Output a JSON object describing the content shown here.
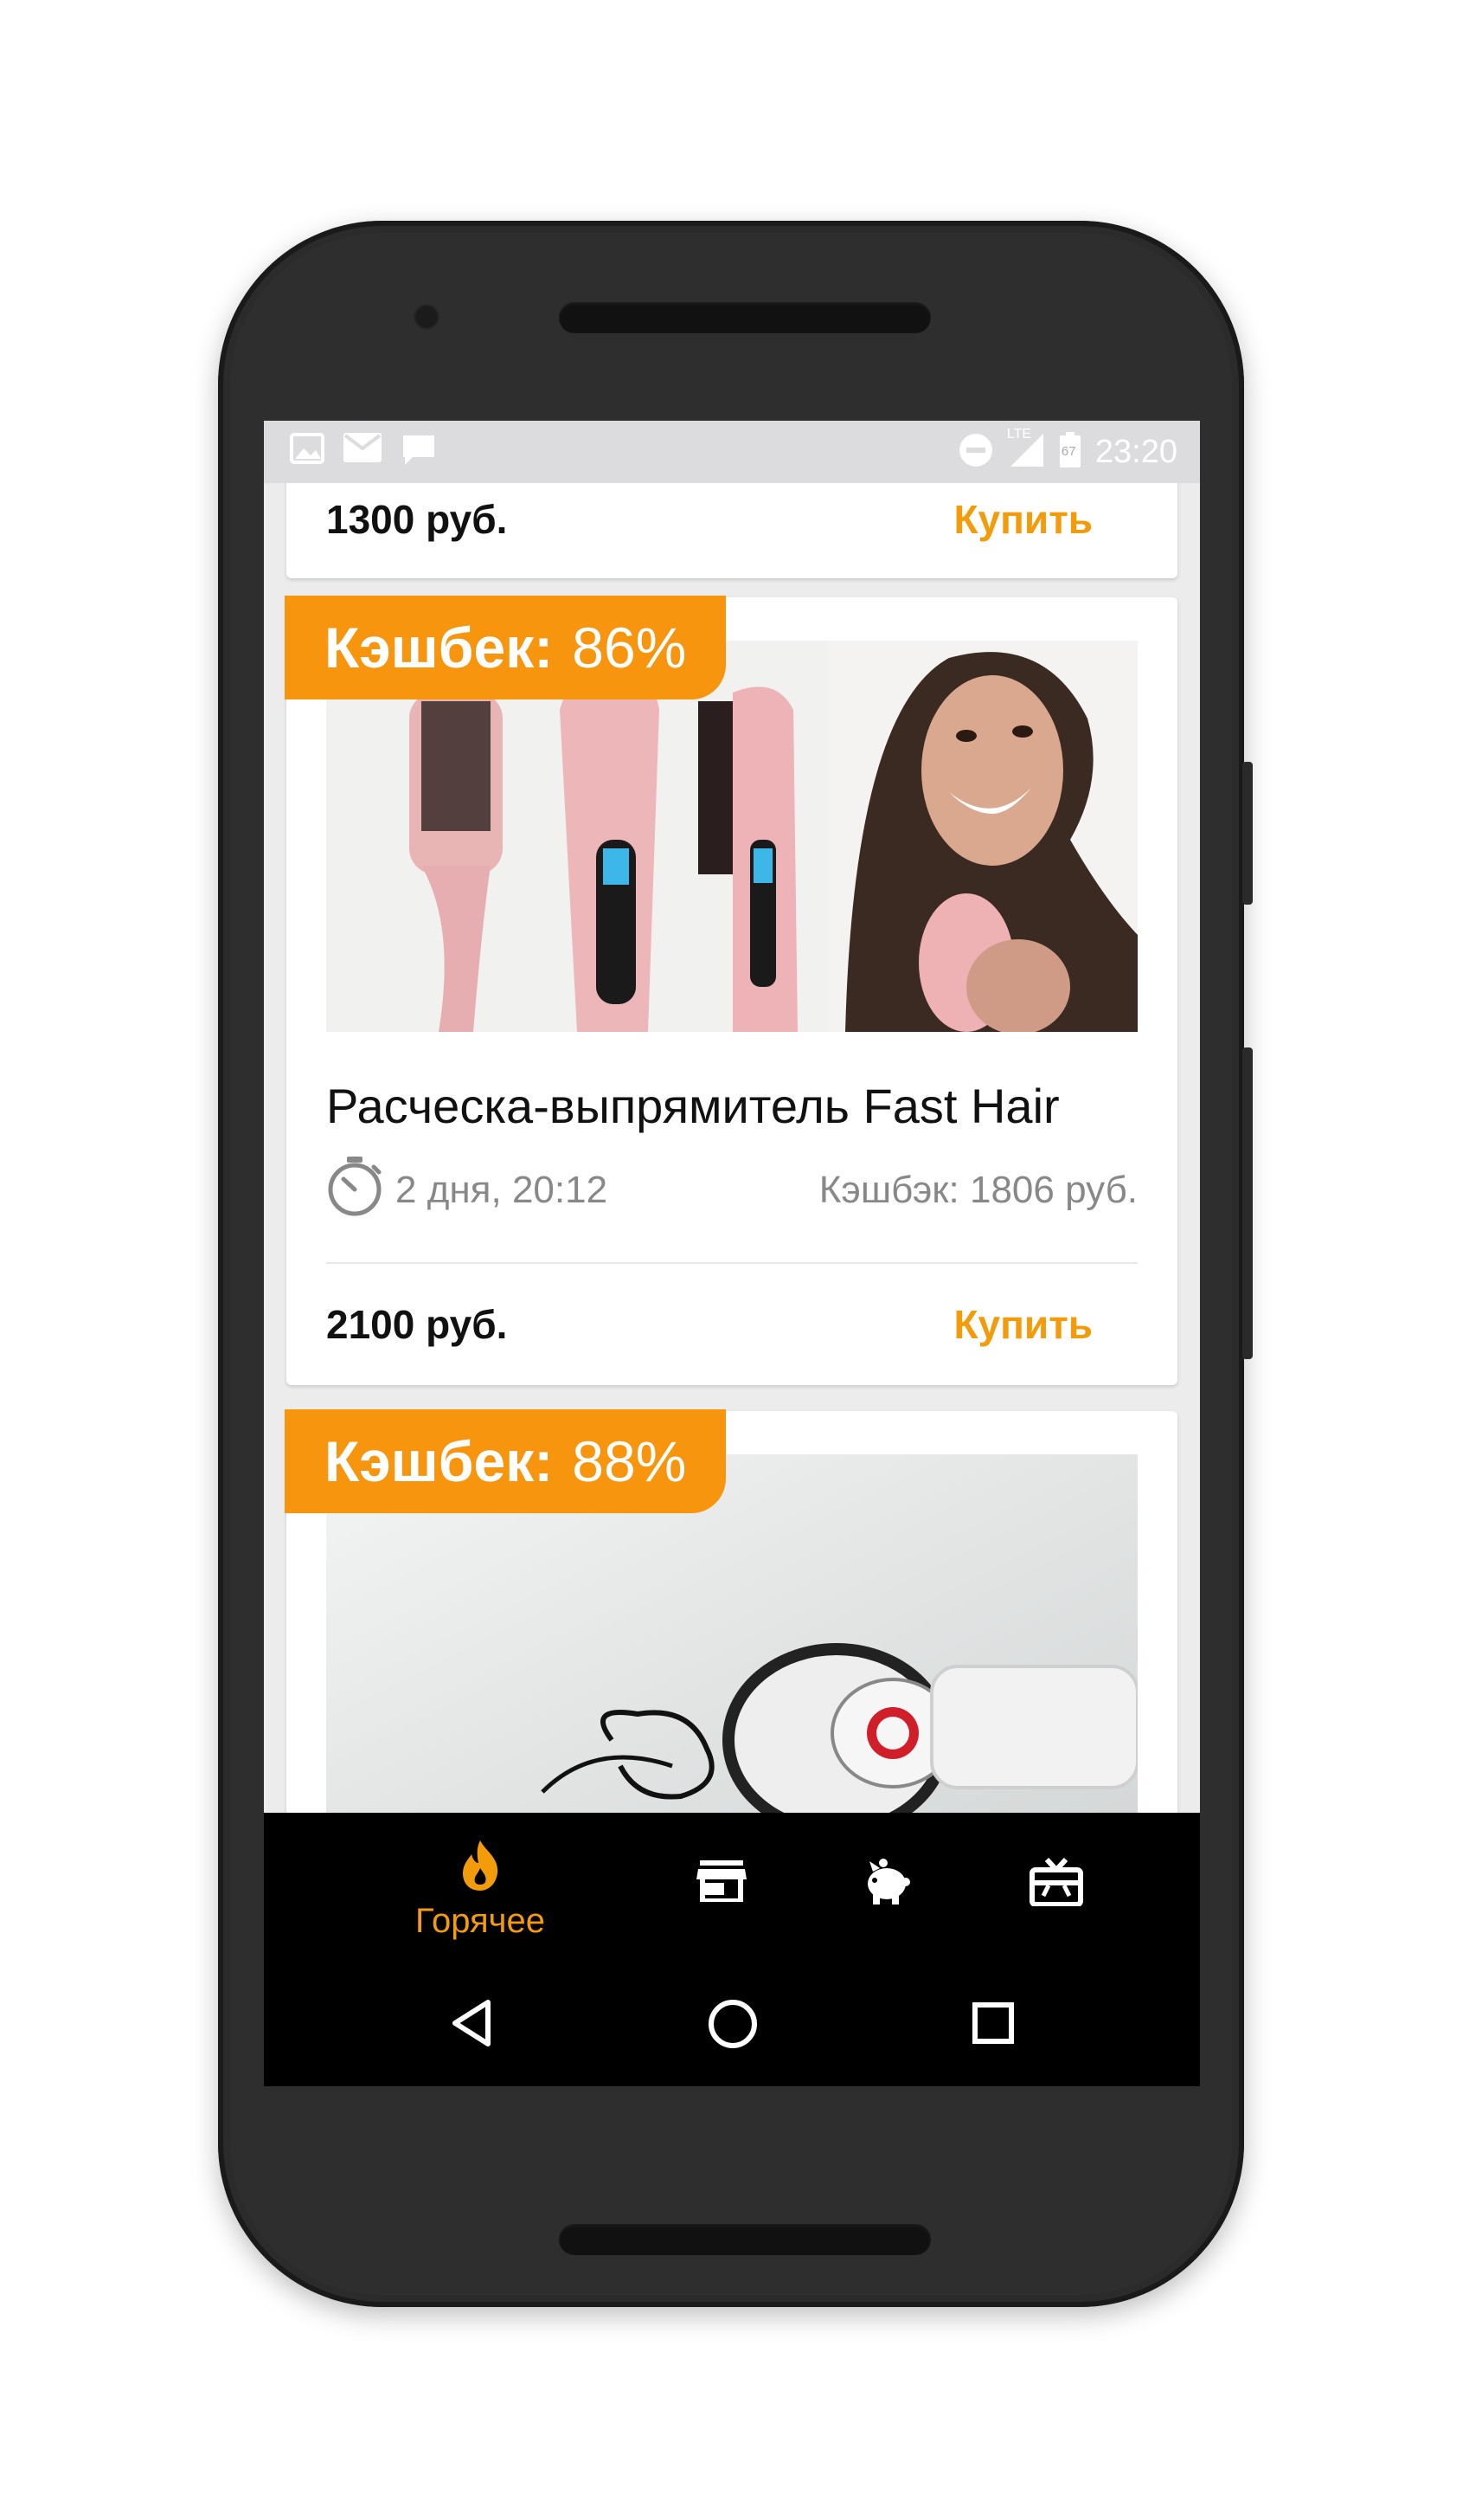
{
  "status_bar": {
    "time": "23:20",
    "network": "LTE",
    "battery": "67",
    "left_icons": [
      "image-notification-icon",
      "mail-icon",
      "chat-icon"
    ]
  },
  "cards": [
    {
      "price": "1300 руб.",
      "buy_label": "Купить"
    },
    {
      "cashback_label": "Кэшбек:",
      "cashback_percent": "86%",
      "title": "Расческа-выпрямитель Fast Hair",
      "time_left": "2 дня, 20:12",
      "cashback_amount": "Кэшбэк: 1806 руб.",
      "price": "2100 руб.",
      "buy_label": "Купить"
    },
    {
      "cashback_label": "Кэшбек:",
      "cashback_percent": "88%"
    }
  ],
  "bottom_nav": {
    "items": [
      {
        "icon": "flame-icon",
        "label": "Горячее",
        "active": true
      },
      {
        "icon": "store-icon",
        "label": ""
      },
      {
        "icon": "piggy-bank-icon",
        "label": ""
      },
      {
        "icon": "gift-card-icon",
        "label": ""
      }
    ]
  },
  "colors": {
    "accent": "#f39c0b",
    "badge": "#f7960e",
    "nav_background": "#000000"
  }
}
